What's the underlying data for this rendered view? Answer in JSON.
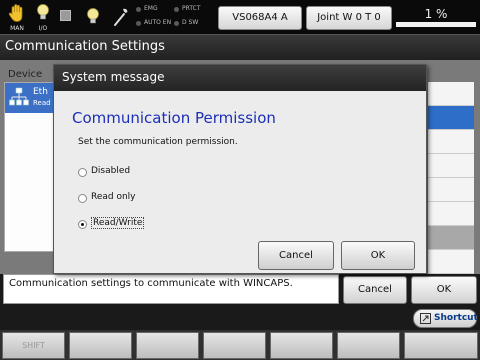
{
  "topbar": {
    "man_label": "MAN",
    "io_label": "I/O",
    "lamps": {
      "emg": "EMG",
      "prtct": "PRTCT",
      "auto_en": "AUTO EN",
      "dsw": "D SW"
    },
    "robot_button": "VS068A4 A",
    "joint_button": "Joint W 0 T 0",
    "speed_percent": "1 %"
  },
  "window": {
    "title": "Communication Settings"
  },
  "main": {
    "device_header": "Device",
    "device_item": {
      "name": "Eth",
      "sub": "Read"
    },
    "icons": {
      "device": "network-icon"
    }
  },
  "status_bar": {
    "text": "Communication settings to communicate with WINCAPS."
  },
  "footer": {
    "cancel": "Cancel",
    "ok": "OK",
    "shortcut": "Shortcut",
    "fkeys": [
      "SHIFT",
      "",
      "",
      "",
      "",
      "",
      "",
      ""
    ]
  },
  "dialog": {
    "title": "System message",
    "heading": "Communication Permission",
    "description": "Set the communication permission.",
    "options": [
      {
        "label": "Disabled",
        "selected": false
      },
      {
        "label": "Read only",
        "selected": false
      },
      {
        "label": "Read/Write",
        "selected": true
      }
    ],
    "cancel": "Cancel",
    "ok": "OK"
  },
  "colors": {
    "heading": "#1d2fb8",
    "selection": "#2f6ec8",
    "shortcut_text": "#0a3a8a"
  }
}
